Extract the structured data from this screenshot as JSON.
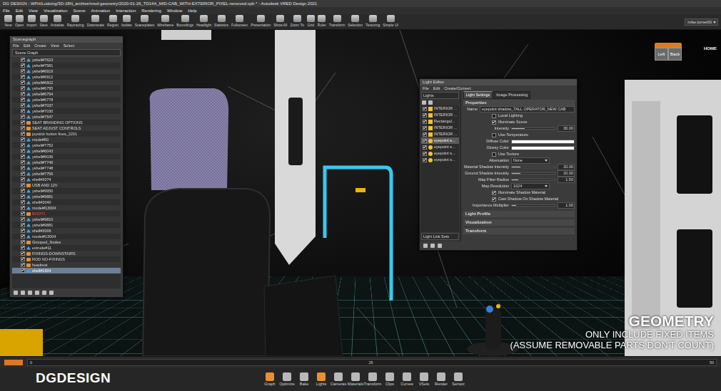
{
  "window": {
    "title": "DG DESIGN - WFH/Ludoing/3D-18N_archive/vred-geometry/2020-01-29_TD14A_MID-CAB_WITH-EXTERIOR_PIXEL-removed.vpb * - Autodesk VRED Design 2021"
  },
  "menu": [
    "File",
    "Edit",
    "View",
    "Visualization",
    "Scene",
    "Animation",
    "Interaction",
    "Rendering",
    "Window",
    "Help"
  ],
  "toolbar": {
    "items": [
      "New",
      "Open",
      "Import",
      "Save",
      "Antialias",
      "Raytracing",
      "Downscale",
      "Region",
      "Isolate",
      "Scaneplates",
      "Wireframe",
      "Boundings",
      "Headlight",
      "Statistics",
      "Fullscreen",
      "Presentation",
      "Show All",
      "Zoom To",
      "Grid",
      "Ruler",
      "Transform",
      "Selection",
      "Texturing",
      "Simple UI"
    ],
    "user": "mike.turner00"
  },
  "navcube": {
    "faces": [
      "Left",
      "Back"
    ],
    "home": "HOME"
  },
  "scenegraph": {
    "title": "Scenegraph",
    "menu": [
      "File",
      "Edit",
      "Create",
      "View",
      "Select"
    ],
    "dropdown": "Scene Graph",
    "nodes": [
      {
        "label": "yshell#7623",
        "kind": "geometry",
        "visible": true,
        "selected": false,
        "warning": false
      },
      {
        "label": "yshell#7581",
        "kind": "geometry",
        "visible": true,
        "selected": false,
        "warning": false
      },
      {
        "label": "yshell#6919",
        "kind": "geometry",
        "visible": true,
        "selected": false,
        "warning": false
      },
      {
        "label": "yshell#6912",
        "kind": "geometry",
        "visible": true,
        "selected": false,
        "warning": false
      },
      {
        "label": "yshell#6602",
        "kind": "geometry",
        "visible": true,
        "selected": false,
        "warning": false
      },
      {
        "label": "yshell#6795",
        "kind": "geometry",
        "visible": true,
        "selected": false,
        "warning": false
      },
      {
        "label": "yshell#6794",
        "kind": "geometry",
        "visible": true,
        "selected": false,
        "warning": false
      },
      {
        "label": "yshell#6778",
        "kind": "geometry",
        "visible": true,
        "selected": false,
        "warning": false
      },
      {
        "label": "yshell#7037",
        "kind": "geometry",
        "visible": true,
        "selected": false,
        "warning": false
      },
      {
        "label": "yshell#7030",
        "kind": "geometry",
        "visible": true,
        "selected": false,
        "warning": false
      },
      {
        "label": "yshell#7547",
        "kind": "geometry",
        "visible": true,
        "selected": false,
        "warning": false
      },
      {
        "label": "SEAT BRANDING OPTIONS",
        "kind": "group",
        "visible": true,
        "selected": false,
        "warning": false
      },
      {
        "label": "SEAT ADJUST CONTROLS",
        "kind": "group",
        "visible": true,
        "selected": false,
        "warning": false
      },
      {
        "label": "joystick button fixes_2201",
        "kind": "group",
        "visible": true,
        "selected": false,
        "warning": false
      },
      {
        "label": "mode#60",
        "kind": "geometry",
        "visible": true,
        "selected": false,
        "warning": false
      },
      {
        "label": "yshell#7752",
        "kind": "geometry",
        "visible": true,
        "selected": false,
        "warning": false
      },
      {
        "label": "yshell#6043",
        "kind": "geometry",
        "visible": true,
        "selected": false,
        "warning": false
      },
      {
        "label": "yshell#6036",
        "kind": "geometry",
        "visible": true,
        "selected": false,
        "warning": false
      },
      {
        "label": "yshell#7746",
        "kind": "geometry",
        "visible": true,
        "selected": false,
        "warning": false
      },
      {
        "label": "yshell#7748",
        "kind": "geometry",
        "visible": true,
        "selected": false,
        "warning": false
      },
      {
        "label": "yshell#7756",
        "kind": "geometry",
        "visible": true,
        "selected": false,
        "warning": false
      },
      {
        "label": "shell#3074",
        "kind": "geometry",
        "visible": true,
        "selected": false,
        "warning": false
      },
      {
        "label": "USB AND 12V",
        "kind": "group",
        "visible": true,
        "selected": false,
        "warning": false
      },
      {
        "label": "yshell#9950",
        "kind": "geometry",
        "visible": true,
        "selected": false,
        "warning": false
      },
      {
        "label": "yshell#9881",
        "kind": "geometry",
        "visible": true,
        "selected": false,
        "warning": false
      },
      {
        "label": "shell#3040",
        "kind": "geometry",
        "visible": true,
        "selected": false,
        "warning": false
      },
      {
        "label": "model#13004",
        "kind": "geometry",
        "visible": true,
        "selected": false,
        "warning": false
      },
      {
        "label": "BOOT1",
        "kind": "group",
        "visible": true,
        "selected": false,
        "warning": true
      },
      {
        "label": "yshell#9810",
        "kind": "geometry",
        "visible": true,
        "selected": false,
        "warning": false
      },
      {
        "label": "yshell#9881",
        "kind": "geometry",
        "visible": true,
        "selected": false,
        "warning": false
      },
      {
        "label": "shell#3006",
        "kind": "geometry",
        "visible": true,
        "selected": false,
        "warning": false
      },
      {
        "label": "model#13004",
        "kind": "geometry",
        "visible": true,
        "selected": false,
        "warning": false
      },
      {
        "label": "Grouped_Nodes",
        "kind": "group",
        "visible": true,
        "selected": false,
        "warning": false
      },
      {
        "label": "extrude#11",
        "kind": "geometry",
        "visible": true,
        "selected": false,
        "warning": false
      },
      {
        "label": "FIXINGS-DOWNSTAIRS",
        "kind": "group",
        "visible": true,
        "selected": false,
        "warning": false
      },
      {
        "label": "ROD NO-FIXINGS",
        "kind": "group",
        "visible": true,
        "selected": false,
        "warning": false
      },
      {
        "label": "headrest",
        "kind": "group",
        "visible": true,
        "selected": false,
        "warning": false
      },
      {
        "label": "shell#1604",
        "kind": "geometry",
        "visible": true,
        "selected": true,
        "warning": false
      }
    ]
  },
  "light_editor": {
    "title": "Light Editor",
    "menu": [
      "File",
      "Edit",
      "Create/Convert"
    ],
    "dropdown": "Lights",
    "lights": [
      {
        "label": "INTERIOR ...",
        "kind": "area",
        "enabled": true,
        "selected": false
      },
      {
        "label": "INTERIOR ...",
        "kind": "area",
        "enabled": true,
        "selected": false
      },
      {
        "label": "Rectangul...",
        "kind": "area",
        "enabled": true,
        "selected": false
      },
      {
        "label": "INTERIOR ...",
        "kind": "area",
        "enabled": true,
        "selected": false
      },
      {
        "label": "INTERIOR ...",
        "kind": "area",
        "enabled": true,
        "selected": false
      },
      {
        "label": "eyepoint s...",
        "kind": "spot",
        "enabled": true,
        "selected": true
      },
      {
        "label": "eyepoint s...",
        "kind": "spot",
        "enabled": true,
        "selected": false
      },
      {
        "label": "eyepoint s...",
        "kind": "spot",
        "enabled": true,
        "selected": false
      },
      {
        "label": "eyepoint s...",
        "kind": "spot",
        "enabled": true,
        "selected": false
      }
    ],
    "link_sets": "Light Link Sets",
    "tabs": [
      {
        "label": "Light Settings",
        "selected": true
      },
      {
        "label": "Image Processing",
        "selected": false
      }
    ],
    "properties": {
      "title": "Properties",
      "name_label": "Name",
      "name_value": "eyepoint shadow_TALL OPERATOR_NEW CAB",
      "rows": [
        {
          "kind": "checkbox",
          "label": "Local Lighting",
          "checked": false
        },
        {
          "kind": "checkbox",
          "label": "Illuminate Scene",
          "checked": true
        },
        {
          "kind": "slider",
          "label": "Intensity",
          "value": "30.00",
          "level": 0.3
        },
        {
          "kind": "checkbox",
          "label": "Use Temperature",
          "checked": false
        },
        {
          "kind": "color",
          "label": "Diffuse Color",
          "color": "#ffffff"
        },
        {
          "kind": "color",
          "label": "Glossy Color",
          "color": "#ffffff"
        },
        {
          "kind": "checkbox",
          "label": "Use Texture",
          "checked": false
        },
        {
          "kind": "dropdown",
          "label": "Attenuation",
          "value": "None"
        },
        {
          "kind": "slider",
          "label": "Material Shadow Intensity",
          "value": "20.00",
          "level": 0.2
        },
        {
          "kind": "slider",
          "label": "Ground Shadow Intensity",
          "value": "20.00",
          "level": 0.2
        },
        {
          "kind": "slider",
          "label": "Map Filter Radius",
          "value": "1.50",
          "level": 0.15
        },
        {
          "kind": "dropdown",
          "label": "Map Resolution",
          "value": "1024"
        },
        {
          "kind": "checkbox",
          "label": "Illuminate Shadow Material",
          "checked": true
        },
        {
          "kind": "checkbox",
          "label": "Cast Shadow On Shadow Material",
          "checked": true
        },
        {
          "kind": "slider",
          "label": "Importance Multiplier",
          "value": "1.00",
          "level": 0.1
        }
      ]
    },
    "sections": [
      "Light Profile",
      "Visualization",
      "Transform"
    ]
  },
  "caption": {
    "heading": "GEOMETRY",
    "lines": [
      "ONLY INCLUDE FIXED ITEMS",
      "(ASSUME REMOVABLE PARTS DON'T COUNT)"
    ]
  },
  "timeline": {
    "ticks": [
      "0",
      "25",
      "50"
    ]
  },
  "dock": [
    {
      "label": "Graph",
      "active": true
    },
    {
      "label": "Optimize",
      "active": false
    },
    {
      "label": "Bake",
      "active": false
    },
    {
      "label": "Lights",
      "active": true
    },
    {
      "label": "Cameras",
      "active": false
    },
    {
      "label": "Materials",
      "active": false
    },
    {
      "label": "Transform",
      "active": false
    },
    {
      "label": "Clips",
      "active": false
    },
    {
      "label": "Curves",
      "active": false
    },
    {
      "label": "VSets",
      "active": false
    },
    {
      "label": "Render",
      "active": false
    },
    {
      "label": "Sensor",
      "active": false
    }
  ],
  "brand": "DGDESIGN"
}
